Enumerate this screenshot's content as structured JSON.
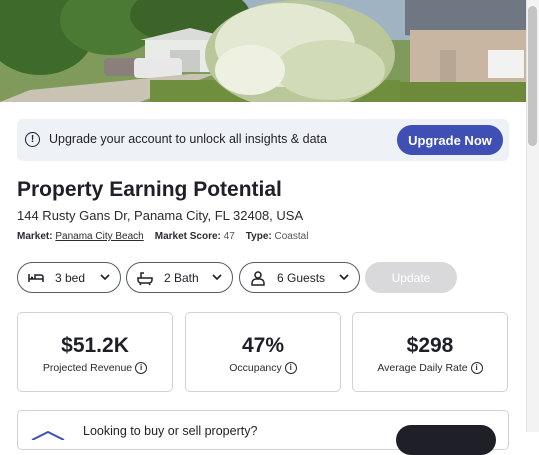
{
  "banner": {
    "icon": "info-icon",
    "text": "Upgrade your account to unlock all insights & data",
    "button_label": "Upgrade Now"
  },
  "property": {
    "title": "Property Earning Potential",
    "address": "144 Rusty Gans Dr, Panama City, FL 32408, USA",
    "market_label": "Market:",
    "market_value": "Panama City Beach",
    "score_label": "Market Score:",
    "score_value": "47",
    "type_label": "Type:",
    "type_value": "Coastal"
  },
  "filters": {
    "bed": "3 bed",
    "bath": "2 Bath",
    "guests": "6 Guests",
    "update_label": "Update"
  },
  "stats": [
    {
      "value": "$51.2K",
      "label": "Projected Revenue"
    },
    {
      "value": "47%",
      "label": "Occupancy"
    },
    {
      "value": "$298",
      "label": "Average Daily Rate"
    }
  ],
  "promo": {
    "text": "Looking to buy or sell property?"
  }
}
